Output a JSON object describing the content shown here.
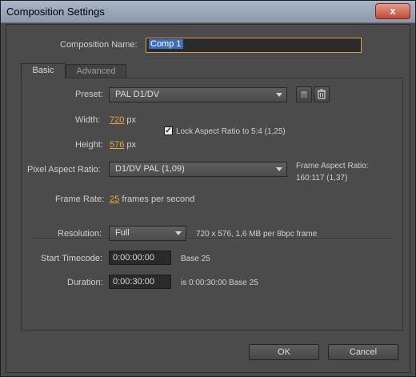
{
  "window": {
    "title": "Composition Settings",
    "close_label": "x"
  },
  "comp_name": {
    "label": "Composition Name:",
    "value": "Comp 1"
  },
  "tabs": [
    {
      "label": "Basic",
      "active": true
    },
    {
      "label": "Advanced",
      "active": false
    }
  ],
  "preset": {
    "label": "Preset:",
    "value": "PAL D1/DV"
  },
  "width": {
    "label": "Width:",
    "value": "720",
    "unit": "px"
  },
  "height": {
    "label": "Height:",
    "value": "576",
    "unit": "px"
  },
  "lock_aspect": {
    "checked": true,
    "label": "Lock Aspect Ratio to 5:4 (1,25)"
  },
  "pixel_aspect": {
    "label": "Pixel Aspect Ratio:",
    "value": "D1/DV PAL (1,09)",
    "frame_label": "Frame Aspect Ratio:",
    "frame_value": "160:117 (1,37)"
  },
  "frame_rate": {
    "label": "Frame Rate:",
    "value": "25",
    "unit": "frames per second"
  },
  "resolution": {
    "label": "Resolution:",
    "value": "Full",
    "info": "720 x 576, 1,6 MB per 8bpc frame"
  },
  "start_timecode": {
    "label": "Start Timecode:",
    "value": "0:00:00:00",
    "info": "Base 25"
  },
  "duration": {
    "label": "Duration:",
    "value": "0:00:30:00",
    "info": "is 0:00:30:00  Base 25"
  },
  "buttons": {
    "ok": "OK",
    "cancel": "Cancel"
  },
  "colors": {
    "accent": "#e4a733",
    "titlebar": "#9aa7b8",
    "background": "#4b4b4b",
    "selection": "#3a6ebf"
  },
  "icons": [
    "save-preset-icon",
    "trash-icon",
    "checkmark-icon",
    "dropdown-arrow-icon",
    "close-icon"
  ]
}
